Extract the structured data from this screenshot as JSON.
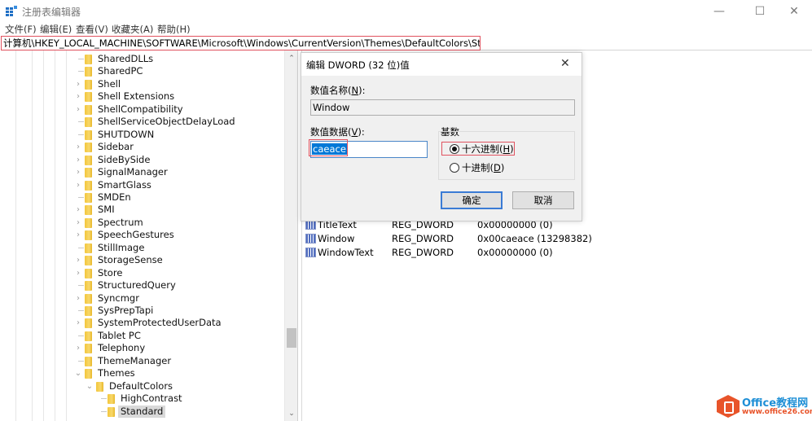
{
  "window": {
    "title": "注册表编辑器",
    "controls": {
      "minimize": "—",
      "maximize": "☐",
      "close": "✕"
    }
  },
  "menu": [
    {
      "label": "文件(F)"
    },
    {
      "label": "编辑(E)"
    },
    {
      "label": "查看(V)"
    },
    {
      "label": "收藏夹(A)"
    },
    {
      "label": "帮助(H)"
    }
  ],
  "address": "计算机\\HKEY_LOCAL_MACHINE\\SOFTWARE\\Microsoft\\Windows\\CurrentVersion\\Themes\\DefaultColors\\Standard",
  "tree": {
    "items": [
      {
        "label": "SharedDLLs",
        "expander": "none",
        "level": 0
      },
      {
        "label": "SharedPC",
        "expander": "none",
        "level": 0
      },
      {
        "label": "Shell",
        "expander": "collapsed",
        "level": 0
      },
      {
        "label": "Shell Extensions",
        "expander": "collapsed",
        "level": 0
      },
      {
        "label": "ShellCompatibility",
        "expander": "collapsed",
        "level": 0
      },
      {
        "label": "ShellServiceObjectDelayLoad",
        "expander": "none",
        "level": 0
      },
      {
        "label": "SHUTDOWN",
        "expander": "none",
        "level": 0
      },
      {
        "label": "Sidebar",
        "expander": "collapsed",
        "level": 0
      },
      {
        "label": "SideBySide",
        "expander": "collapsed",
        "level": 0
      },
      {
        "label": "SignalManager",
        "expander": "collapsed",
        "level": 0
      },
      {
        "label": "SmartGlass",
        "expander": "collapsed",
        "level": 0
      },
      {
        "label": "SMDEn",
        "expander": "none",
        "level": 0
      },
      {
        "label": "SMI",
        "expander": "collapsed",
        "level": 0
      },
      {
        "label": "Spectrum",
        "expander": "collapsed",
        "level": 0
      },
      {
        "label": "SpeechGestures",
        "expander": "collapsed",
        "level": 0
      },
      {
        "label": "StillImage",
        "expander": "none",
        "level": 0
      },
      {
        "label": "StorageSense",
        "expander": "collapsed",
        "level": 0
      },
      {
        "label": "Store",
        "expander": "collapsed",
        "level": 0
      },
      {
        "label": "StructuredQuery",
        "expander": "none",
        "level": 0
      },
      {
        "label": "Syncmgr",
        "expander": "collapsed",
        "level": 0
      },
      {
        "label": "SysPrepTapi",
        "expander": "none",
        "level": 0
      },
      {
        "label": "SystemProtectedUserData",
        "expander": "collapsed",
        "level": 0
      },
      {
        "label": "Tablet PC",
        "expander": "none",
        "level": 0
      },
      {
        "label": "Telephony",
        "expander": "collapsed",
        "level": 0
      },
      {
        "label": "ThemeManager",
        "expander": "none",
        "level": 0
      },
      {
        "label": "Themes",
        "expander": "expanded",
        "level": 0
      },
      {
        "label": "DefaultColors",
        "expander": "expanded",
        "level": 1
      },
      {
        "label": "HighContrast",
        "expander": "none",
        "level": 2
      },
      {
        "label": "Standard",
        "expander": "none",
        "level": 2,
        "selected": true
      }
    ]
  },
  "values": [
    {
      "name": "TitleText",
      "type": "REG_DWORD",
      "data": "0x00000000 (0)"
    },
    {
      "name": "Window",
      "type": "REG_DWORD",
      "data": "0x00caeace (13298382)"
    },
    {
      "name": "WindowText",
      "type": "REG_DWORD",
      "data": "0x00000000 (0)"
    }
  ],
  "dialog": {
    "title": "编辑 DWORD (32 位)值",
    "close": "✕",
    "name_label": "数值名称(",
    "name_key": "N",
    "name_suffix": "):",
    "name_value": "Window",
    "data_label": "数值数据(",
    "data_key": "V",
    "data_suffix": "):",
    "data_value": "caeace",
    "base_label": "基数",
    "radix_options": [
      {
        "label": "十六进制(",
        "key": "H",
        "suffix": ")",
        "checked": true
      },
      {
        "label": "十进制(",
        "key": "D",
        "suffix": ")",
        "checked": false
      }
    ],
    "ok_label": "确定",
    "cancel_label": "取消"
  },
  "watermark": {
    "title": "Office教程网",
    "url": "www.office26.com"
  },
  "colors": {
    "highlight_border": "#e0525f",
    "selection_blue": "#0078d7",
    "folder_yellow": "#f3c63c"
  }
}
